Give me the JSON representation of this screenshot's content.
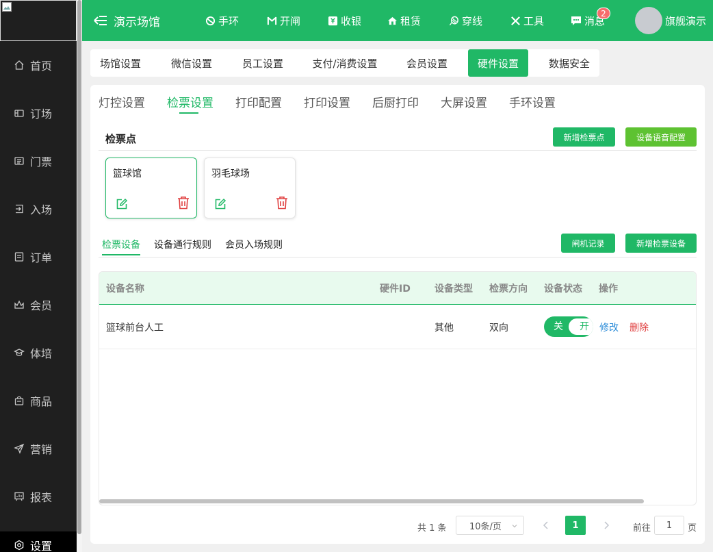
{
  "header": {
    "title": "演示场馆",
    "nav": [
      {
        "label": "手环",
        "icon": "bracelet-icon"
      },
      {
        "label": "开闸",
        "icon": "gate-icon"
      },
      {
        "label": "收银",
        "icon": "cashier-icon"
      },
      {
        "label": "租赁",
        "icon": "rent-icon"
      },
      {
        "label": "穿线",
        "icon": "stringing-icon"
      },
      {
        "label": "工具",
        "icon": "tools-icon"
      },
      {
        "label": "消息",
        "icon": "message-icon"
      }
    ],
    "message_badge": "2",
    "user_name": "旗舰演示"
  },
  "sidebar": {
    "items": [
      {
        "label": "首页",
        "icon": "home-icon"
      },
      {
        "label": "订场",
        "icon": "booking-icon"
      },
      {
        "label": "门票",
        "icon": "ticket-icon"
      },
      {
        "label": "入场",
        "icon": "entry-icon"
      },
      {
        "label": "订单",
        "icon": "order-icon"
      },
      {
        "label": "会员",
        "icon": "member-icon"
      },
      {
        "label": "体培",
        "icon": "training-icon"
      },
      {
        "label": "商品",
        "icon": "goods-icon"
      },
      {
        "label": "营销",
        "icon": "marketing-icon"
      },
      {
        "label": "报表",
        "icon": "report-icon"
      },
      {
        "label": "设置",
        "icon": "settings-icon"
      }
    ],
    "active": "设置"
  },
  "top_tabs": [
    "场馆设置",
    "微信设置",
    "员工设置",
    "支付/消费设置",
    "会员设置",
    "硬件设置",
    "数据安全"
  ],
  "top_tab_active": "硬件设置",
  "sub_tabs": [
    "灯控设置",
    "检票设置",
    "打印配置",
    "打印设置",
    "后厨打印",
    "大屏设置",
    "手环设置"
  ],
  "sub_tab_active": "检票设置",
  "checkpoint": {
    "title": "检票点",
    "add_button": "新增检票点",
    "voice_button": "设备语音配置",
    "points": [
      "篮球馆",
      "羽毛球场"
    ]
  },
  "device_tabs": [
    "检票设备",
    "设备通行规则",
    "会员入场规则"
  ],
  "device_tab_active": "检票设备",
  "device_buttons": {
    "gate_records": "闸机记录",
    "add_device": "新增检票设备"
  },
  "table": {
    "columns": [
      "设备名称",
      "硬件ID",
      "设备类型",
      "检票方向",
      "设备状态",
      "操作"
    ],
    "rows": [
      {
        "name": "篮球前台人工",
        "hardware_id": "",
        "type": "其他",
        "direction": "双向",
        "status_off": "关",
        "status_on": "开",
        "edit": "修改",
        "delete": "删除"
      }
    ]
  },
  "pagination": {
    "total": "共 1 条",
    "page_size": "10条/页",
    "current": "1",
    "goto_label": "前往",
    "goto_value": "1",
    "page_label": "页"
  },
  "colors": {
    "primary": "#20b866",
    "lime": "#5ec232",
    "danger": "#e04040",
    "link": "#2a8bd8",
    "sidebar": "#1f1f1f"
  }
}
